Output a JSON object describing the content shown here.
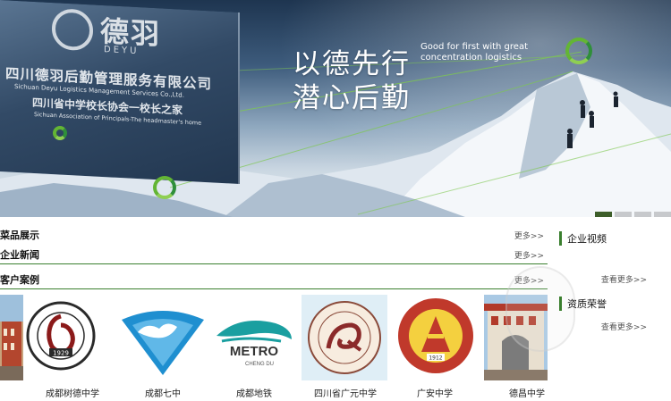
{
  "banner": {
    "plaque": {
      "logo_text": "德羽",
      "logo_sub": "DEYU",
      "line1": "四川德羽后勤管理服务有限公司",
      "line2": "Sichuan Deyu Logistics Management Services Co.,Ltd.",
      "line3": "四川省中学校长协会一校长之家",
      "line4": "Sichuan Association of Principals-The headmaster's home"
    },
    "slogan_line1": "以德先行",
    "slogan_line2": "潜心后勤",
    "slogan_en": "Good for first with great concentration logistics",
    "slide_count": 4,
    "active_slide": 0
  },
  "sections": [
    {
      "title": "菜品展示",
      "more": "更多>>"
    },
    {
      "title": "企业新闻",
      "more": "更多>>"
    },
    {
      "title": "客户案例",
      "more": "更多>>"
    }
  ],
  "clients": [
    {
      "name": "成都树德中学",
      "icon": "shude-school-seal"
    },
    {
      "name": "成都七中",
      "icon": "chengdu-no7-logo"
    },
    {
      "name": "成都地铁",
      "icon": "chengdu-metro-logo"
    },
    {
      "name": "四川省广元中学",
      "icon": "guangyuan-school-seal"
    },
    {
      "name": "广安中学",
      "icon": "guangan-school-seal"
    },
    {
      "name": "德昌中学",
      "icon": "dechang-school-photo"
    }
  ],
  "client_logo_text": {
    "metro": "METRO",
    "metro_sub": "CHENG DU",
    "shude_year": "1929",
    "guangan_year": "1912"
  },
  "sidebar": [
    {
      "title": "企业视频",
      "more": "查看更多>>"
    },
    {
      "title": "资质荣誉",
      "more": "查看更多>>"
    }
  ],
  "colors": {
    "accent_green": "#3a7f2e",
    "ring_green": "#63b534"
  }
}
